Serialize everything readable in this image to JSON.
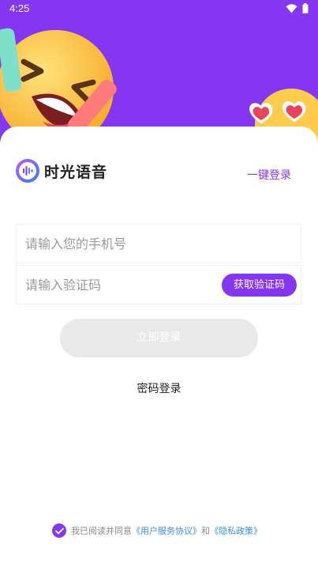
{
  "status_bar": {
    "time": "4:25",
    "wifi_icon": "wifi-icon",
    "battery_icon": "battery-icon"
  },
  "brand": {
    "name": "时光语音",
    "logo_icon": "voice-wave-logo"
  },
  "header": {
    "one_key_login": "一键登录"
  },
  "form": {
    "phone_placeholder": "请输入您的手机号",
    "phone_value": "",
    "code_placeholder": "请输入验证码",
    "code_value": "",
    "get_code_label": "获取验证码",
    "login_label": "立即登录",
    "password_login": "密码登录"
  },
  "agreement": {
    "prefix": "我已阅读并同意",
    "user_agreement": "《用户服务协议》",
    "and": "和",
    "privacy_policy": "《隐私政策》",
    "checked": true
  },
  "colors": {
    "accent": "#8436f0",
    "link": "#3a8ee6",
    "disabled_button": "#e9e9e9"
  }
}
